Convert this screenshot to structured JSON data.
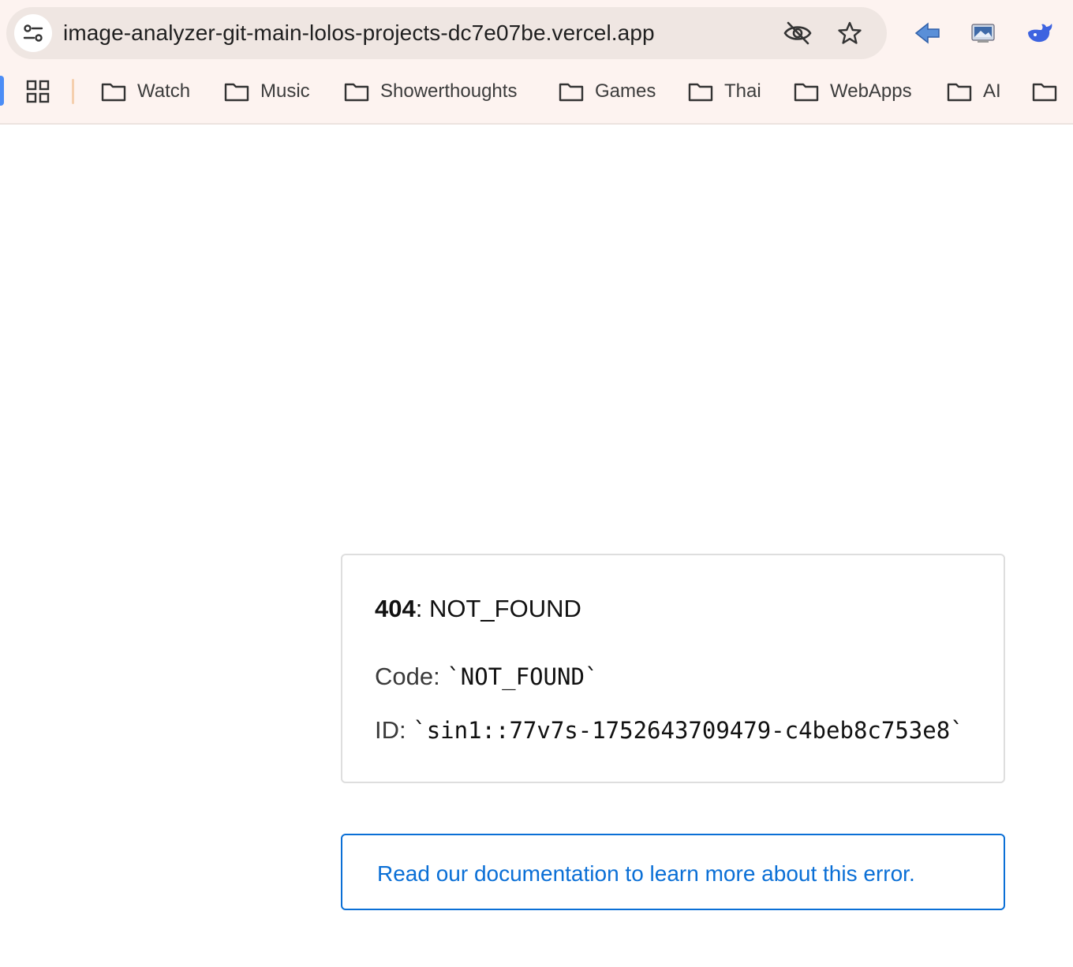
{
  "browser": {
    "url": "image-analyzer-git-main-lolos-projects-dc7e07be.vercel.app",
    "icons": [
      "site-settings-icon",
      "eye-off-icon",
      "star-icon",
      "extension-back-arrow-icon",
      "extension-image-icon",
      "extension-whale-icon",
      "apps-grid-icon",
      "folder-icon"
    ],
    "bookmarks": [
      {
        "label": "Watch"
      },
      {
        "label": "Music"
      },
      {
        "label": "Showerthoughts"
      },
      {
        "label": "Games"
      },
      {
        "label": "Thai"
      },
      {
        "label": "WebApps"
      },
      {
        "label": "AI"
      },
      {
        "label": ""
      }
    ]
  },
  "error": {
    "status": "404",
    "separator": ":",
    "title": " NOT_FOUND",
    "code_label": "Code: ",
    "code_value": "`NOT_FOUND`",
    "id_label": "ID: ",
    "id_value": "`sin1::77v7s-1752643709479-c4beb8c753e8`"
  },
  "docs": {
    "link_text": "Read our documentation to learn more about this error."
  },
  "colors": {
    "chrome_bg": "#fdf3f0",
    "omnibox_bg": "#efe6e2",
    "link": "#0a6fd6",
    "card_border": "#dedede"
  }
}
